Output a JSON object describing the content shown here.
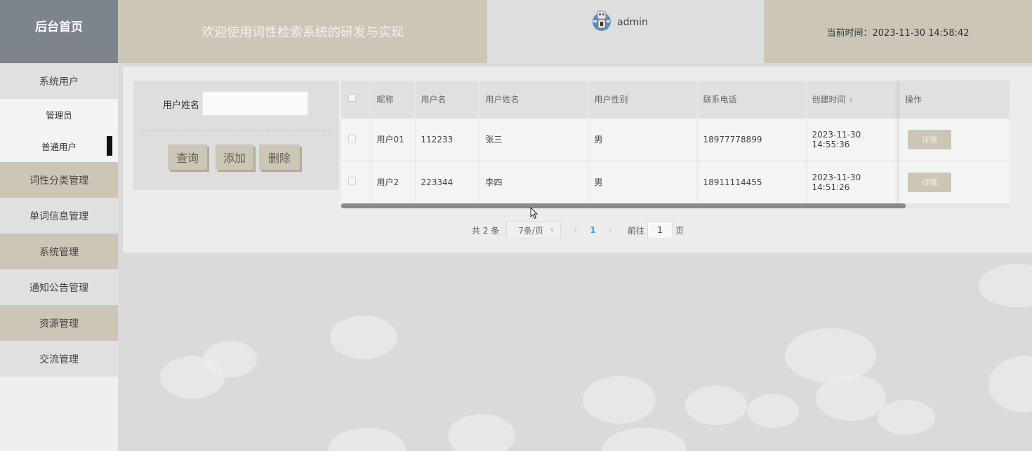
{
  "header": {
    "brand": "后台首页",
    "welcome": "欢迎使用词性检索系统的研发与实现",
    "username": "admin",
    "time_label": "当前时间：2023-11-30 14:58:42"
  },
  "sidebar": {
    "items": [
      {
        "label": "系统用户"
      },
      {
        "label": "管理员"
      },
      {
        "label": "普通用户"
      },
      {
        "label": "词性分类管理"
      },
      {
        "label": "单词信息管理"
      },
      {
        "label": "系统管理"
      },
      {
        "label": "通知公告管理"
      },
      {
        "label": "资源管理"
      },
      {
        "label": "交流管理"
      }
    ]
  },
  "search": {
    "label": "用户姓名",
    "value": "",
    "buttons": {
      "query": "查询",
      "add": "添加",
      "delete": "删除"
    }
  },
  "table": {
    "columns": [
      "昵称",
      "用户名",
      "用户姓名",
      "用户性别",
      "联系电话",
      "创建时间",
      "操作"
    ],
    "sort_icon": "⇕",
    "rows": [
      {
        "nickname": "用户01",
        "username": "112233",
        "realname": "张三",
        "gender": "男",
        "phone": "18977778899",
        "created": "2023-11-30 14:55:36",
        "action": "详情"
      },
      {
        "nickname": "用户2",
        "username": "223344",
        "realname": "李四",
        "gender": "男",
        "phone": "18911114455",
        "created": "2023-11-30 14:51:26",
        "action": "详情"
      }
    ]
  },
  "pagination": {
    "total": "共 2 条",
    "page_size": "7条/页",
    "current_page": "1",
    "goto_label": "前往",
    "goto_value": "1",
    "page_suffix": "页"
  }
}
